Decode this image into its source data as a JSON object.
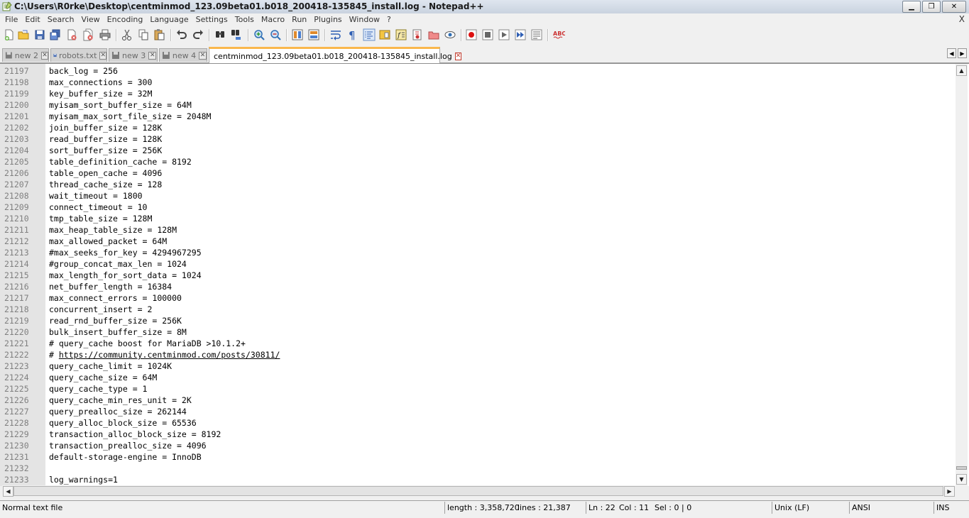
{
  "window": {
    "title": "C:\\Users\\R0rke\\Desktop\\centminmod_123.09beta01.b018_200418-135845_install.log - Notepad++",
    "minimize_label": "▁",
    "maximize_label": "❐",
    "close_label": "✕"
  },
  "menu": {
    "items": [
      "File",
      "Edit",
      "Search",
      "View",
      "Encoding",
      "Language",
      "Settings",
      "Tools",
      "Macro",
      "Run",
      "Plugins",
      "Window",
      "?"
    ],
    "close_label": "X"
  },
  "toolbar": {
    "icons": [
      "new-file-icon",
      "open-file-icon",
      "save-icon",
      "save-all-icon",
      "close-icon",
      "close-all-icon",
      "print-icon",
      "cut-icon",
      "copy-icon",
      "paste-icon",
      "undo-icon",
      "redo-icon",
      "find-icon",
      "replace-icon",
      "zoom-in-icon",
      "zoom-out-icon",
      "sync-vertical-icon",
      "sync-horizontal-icon",
      "word-wrap-icon",
      "show-all-chars-icon",
      "indent-guide-icon",
      "doc-map-icon",
      "function-list-icon",
      "folder-as-workspace-icon",
      "monitor-icon",
      "record-macro-icon",
      "stop-record-icon",
      "play-macro-icon",
      "run-macro-multiple-icon",
      "save-macro-icon",
      "spellcheck-icon"
    ],
    "spellcheck_text": "ABC"
  },
  "tabs": [
    {
      "label": "new 2",
      "active": false
    },
    {
      "label": "robots.txt",
      "active": false
    },
    {
      "label": "new 3",
      "active": false
    },
    {
      "label": "new 4",
      "active": false
    },
    {
      "label": "centminmod_123.09beta01.b018_200418-135845_install.log",
      "active": true
    }
  ],
  "tab_close_label": "✕",
  "tab_nav": {
    "left": "◀",
    "right": "▶"
  },
  "editor": {
    "lines": [
      {
        "num": "21197",
        "text": "back_log = 256"
      },
      {
        "num": "21198",
        "text": "max_connections = 300"
      },
      {
        "num": "21199",
        "text": "key_buffer_size = 32M"
      },
      {
        "num": "21200",
        "text": "myisam_sort_buffer_size = 64M"
      },
      {
        "num": "21201",
        "text": "myisam_max_sort_file_size = 2048M"
      },
      {
        "num": "21202",
        "text": "join_buffer_size = 128K"
      },
      {
        "num": "21203",
        "text": "read_buffer_size = 128K"
      },
      {
        "num": "21204",
        "text": "sort_buffer_size = 256K"
      },
      {
        "num": "21205",
        "text": "table_definition_cache = 8192"
      },
      {
        "num": "21206",
        "text": "table_open_cache = 4096"
      },
      {
        "num": "21207",
        "text": "thread_cache_size = 128"
      },
      {
        "num": "21208",
        "text": "wait_timeout = 1800"
      },
      {
        "num": "21209",
        "text": "connect_timeout = 10"
      },
      {
        "num": "21210",
        "text": "tmp_table_size = 128M"
      },
      {
        "num": "21211",
        "text": "max_heap_table_size = 128M"
      },
      {
        "num": "21212",
        "text": "max_allowed_packet = 64M"
      },
      {
        "num": "21213",
        "text": "#max_seeks_for_key = 4294967295"
      },
      {
        "num": "21214",
        "text": "#group_concat_max_len = 1024"
      },
      {
        "num": "21215",
        "text": "max_length_for_sort_data = 1024"
      },
      {
        "num": "21216",
        "text": "net_buffer_length = 16384"
      },
      {
        "num": "21217",
        "text": "max_connect_errors = 100000"
      },
      {
        "num": "21218",
        "text": "concurrent_insert = 2"
      },
      {
        "num": "21219",
        "text": "read_rnd_buffer_size = 256K"
      },
      {
        "num": "21220",
        "text": "bulk_insert_buffer_size = 8M"
      },
      {
        "num": "21221",
        "text": "# query_cache boost for MariaDB >10.1.2+"
      },
      {
        "num": "21222",
        "text": "# https://community.centminmod.com/posts/30811/",
        "link": "https://community.centminmod.com/posts/30811/"
      },
      {
        "num": "21223",
        "text": "query_cache_limit = 1024K"
      },
      {
        "num": "21224",
        "text": "query_cache_size = 64M"
      },
      {
        "num": "21225",
        "text": "query_cache_type = 1"
      },
      {
        "num": "21226",
        "text": "query_cache_min_res_unit = 2K"
      },
      {
        "num": "21227",
        "text": "query_prealloc_size = 262144"
      },
      {
        "num": "21228",
        "text": "query_alloc_block_size = 65536"
      },
      {
        "num": "21229",
        "text": "transaction_alloc_block_size = 8192"
      },
      {
        "num": "21230",
        "text": "transaction_prealloc_size = 4096"
      },
      {
        "num": "21231",
        "text": "default-storage-engine = InnoDB"
      },
      {
        "num": "21232",
        "text": ""
      },
      {
        "num": "21233",
        "text": "log_warnings=1"
      }
    ]
  },
  "scroll": {
    "up": "▲",
    "down": "▼",
    "left": "◀",
    "right": "▶"
  },
  "status": {
    "file_type": "Normal text file",
    "length": "length : 3,358,720",
    "lines": "lines : 21,387",
    "ln": "Ln : 22",
    "col": "Col : 11",
    "sel": "Sel : 0 | 0",
    "eol": "Unix (LF)",
    "encoding": "ANSI",
    "mode": "INS"
  },
  "colors": {
    "active_tab_accent": "#fab74d",
    "gutter": "#e4e4e4",
    "line_number": "#808080"
  }
}
